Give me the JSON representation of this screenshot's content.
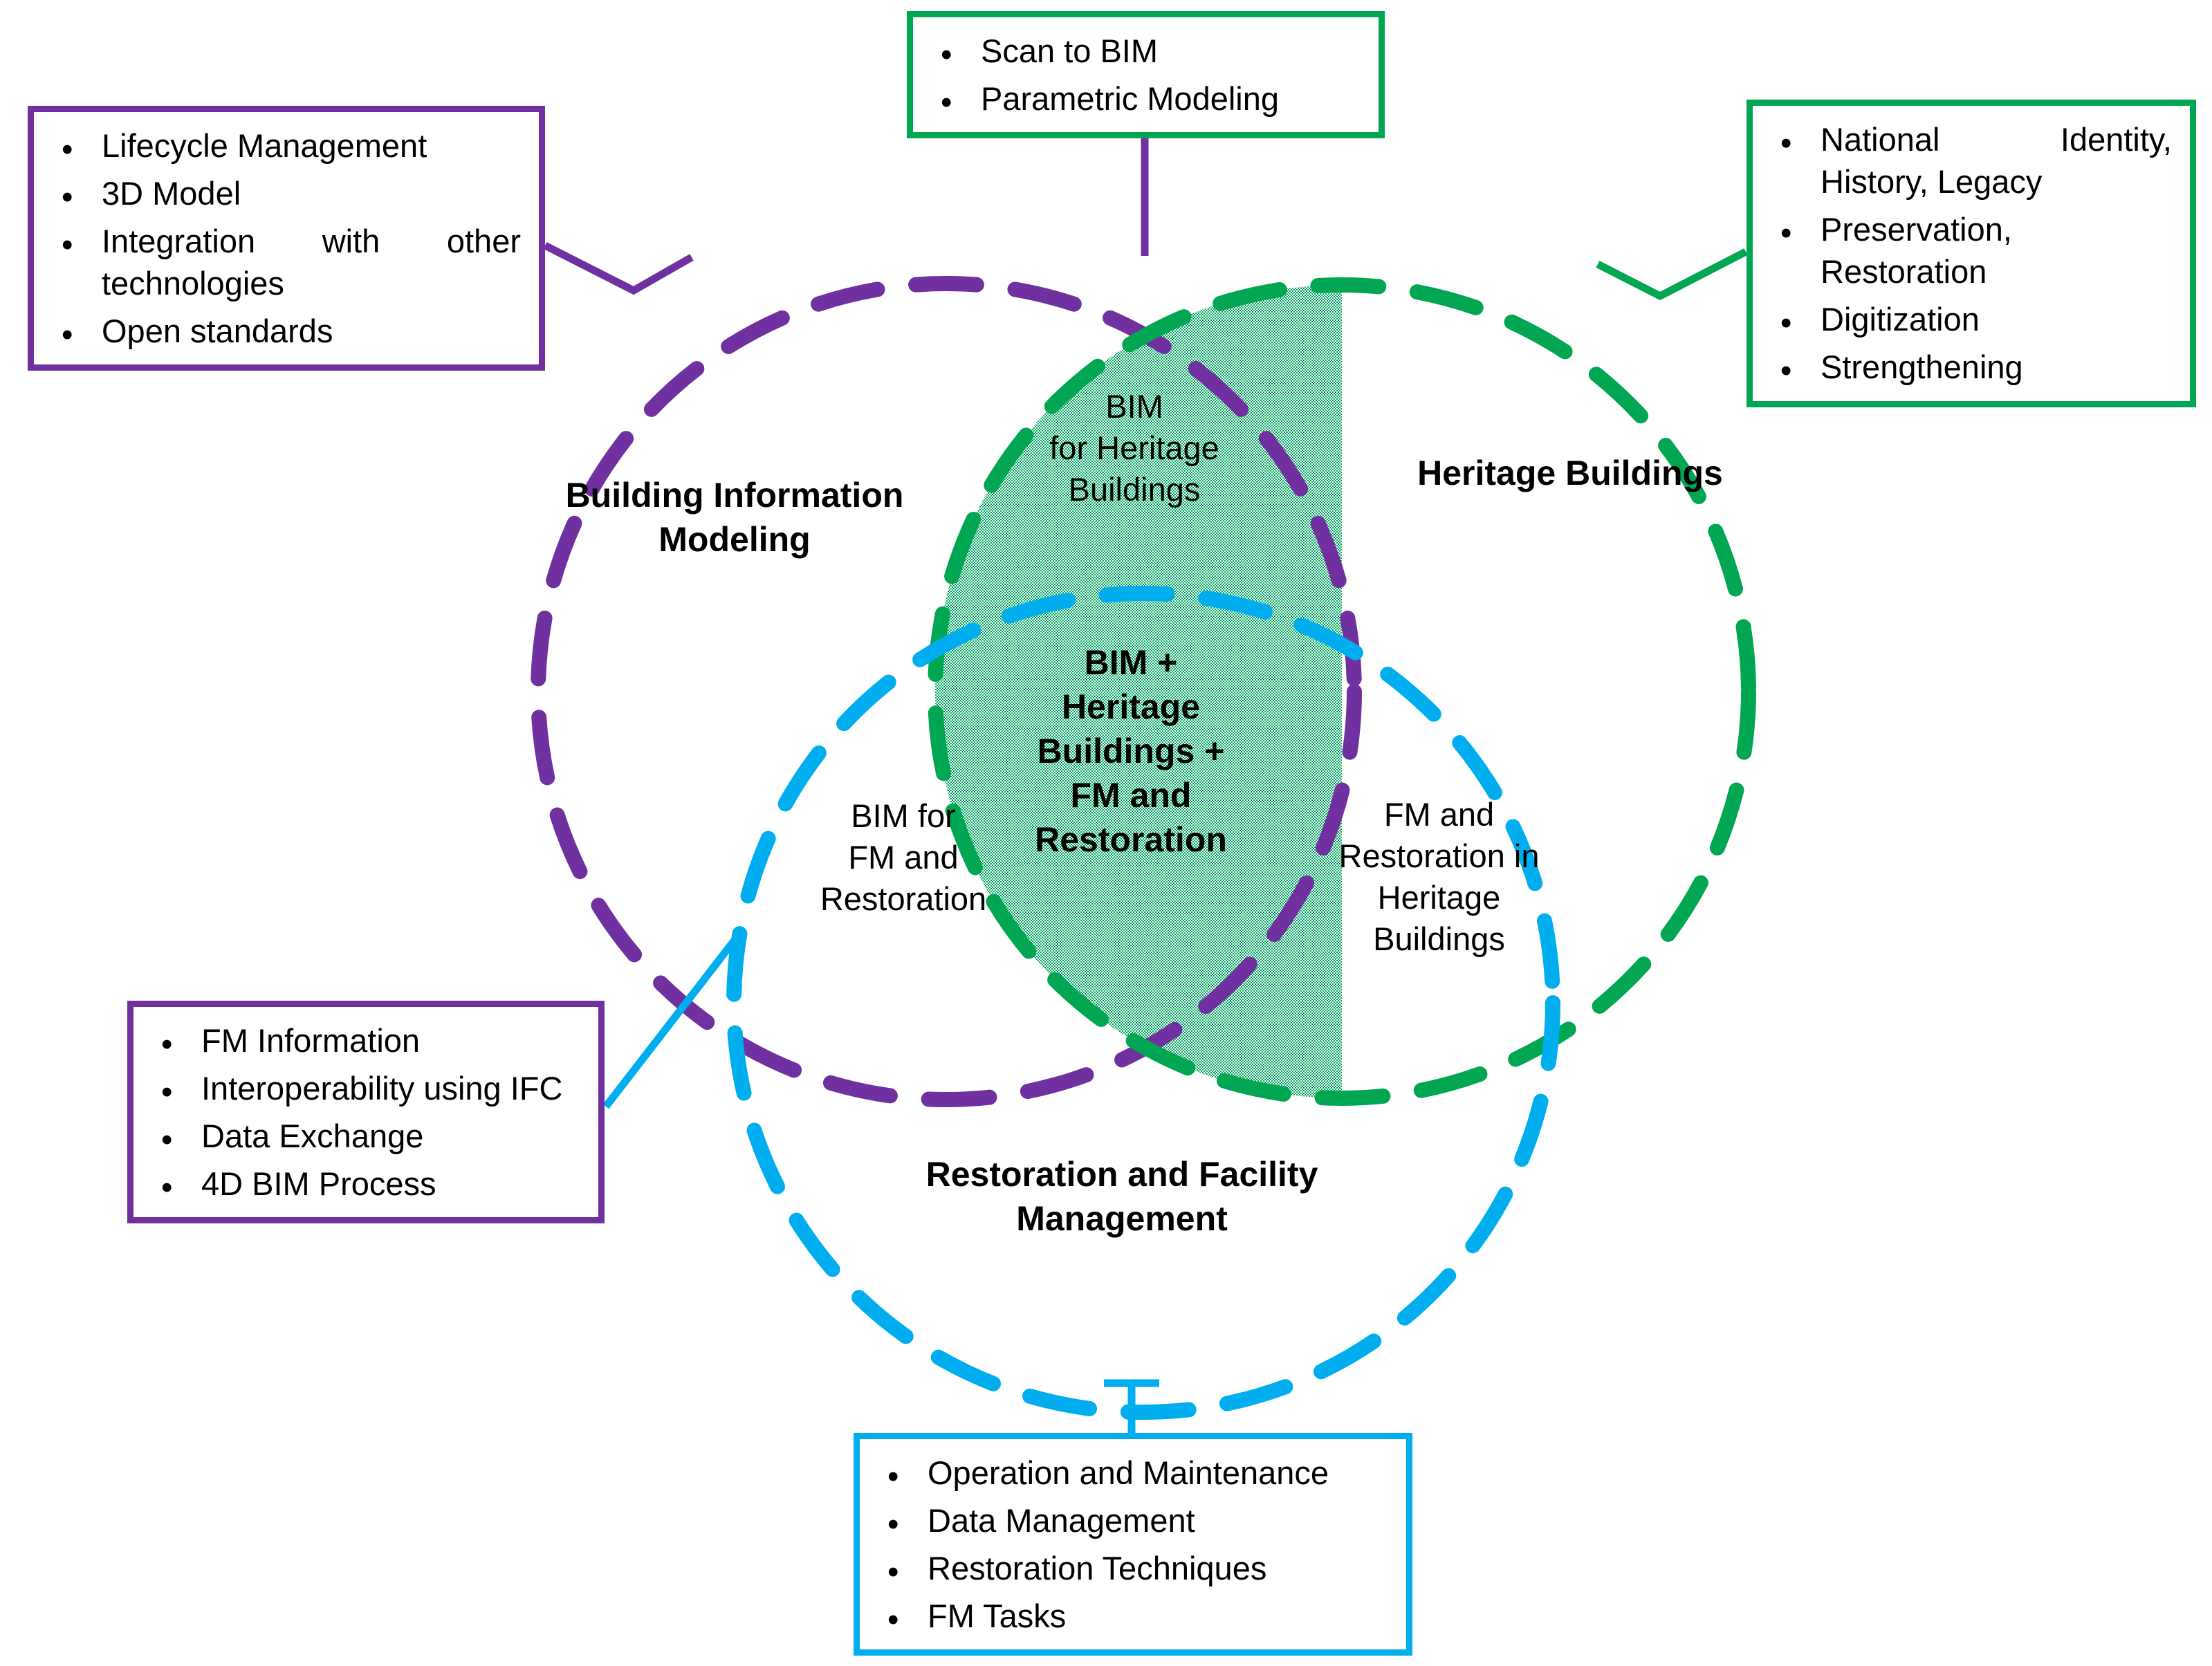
{
  "diagram": {
    "title": "BIM for Heritage Buildings Venn Diagram",
    "colors": {
      "purple": "#7030A0",
      "green": "#00A651",
      "blue": "#00AEEF",
      "shade_fill": "#80D3A8",
      "text": "#000000",
      "background": "#FFFFFF"
    }
  },
  "circles": {
    "bim": {
      "label": "Building Information\nModeling",
      "color": "#7030A0"
    },
    "heritage": {
      "label": "Heritage Buildings",
      "color": "#00A651"
    },
    "restoration_fm": {
      "label": "Restoration and Facility\nManagement",
      "color": "#00AEEF"
    }
  },
  "intersections": {
    "bim_heritage": "BIM\nfor Heritage\nBuildings",
    "bim_fm": "BIM for\nFM and\nRestoration",
    "heritage_fm": "FM and\nRestoration in\nHeritage\nBuildings",
    "center": "BIM +\nHeritage\nBuildings +\nFM and\nRestoration"
  },
  "callouts": {
    "bim": {
      "border_color": "#7030A0",
      "items": [
        "Lifecycle Management",
        "3D Model",
        "Integration with other technologies",
        "Open standards"
      ]
    },
    "scan": {
      "border_color": "#00A651",
      "connector_color": "#7030A0",
      "items": [
        "Scan to BIM",
        "Parametric Modeling"
      ]
    },
    "heritage": {
      "border_color": "#00A651",
      "connector_color": "#00A651",
      "items": [
        "National Identity, History, Legacy",
        "Preservation, Restoration",
        "Digitization",
        "Strengthening"
      ]
    },
    "fm": {
      "border_color": "#7030A0",
      "connector_color": "#00AEEF",
      "items": [
        "FM Information",
        "Interoperability using IFC",
        "Data Exchange",
        "4D BIM Process"
      ]
    },
    "restoration": {
      "border_color": "#00AEEF",
      "connector_color": "#00AEEF",
      "items": [
        "Operation and Maintenance",
        "Data Management",
        "Restoration Techniques",
        "FM Tasks"
      ]
    }
  },
  "bullet_glyph": "•"
}
